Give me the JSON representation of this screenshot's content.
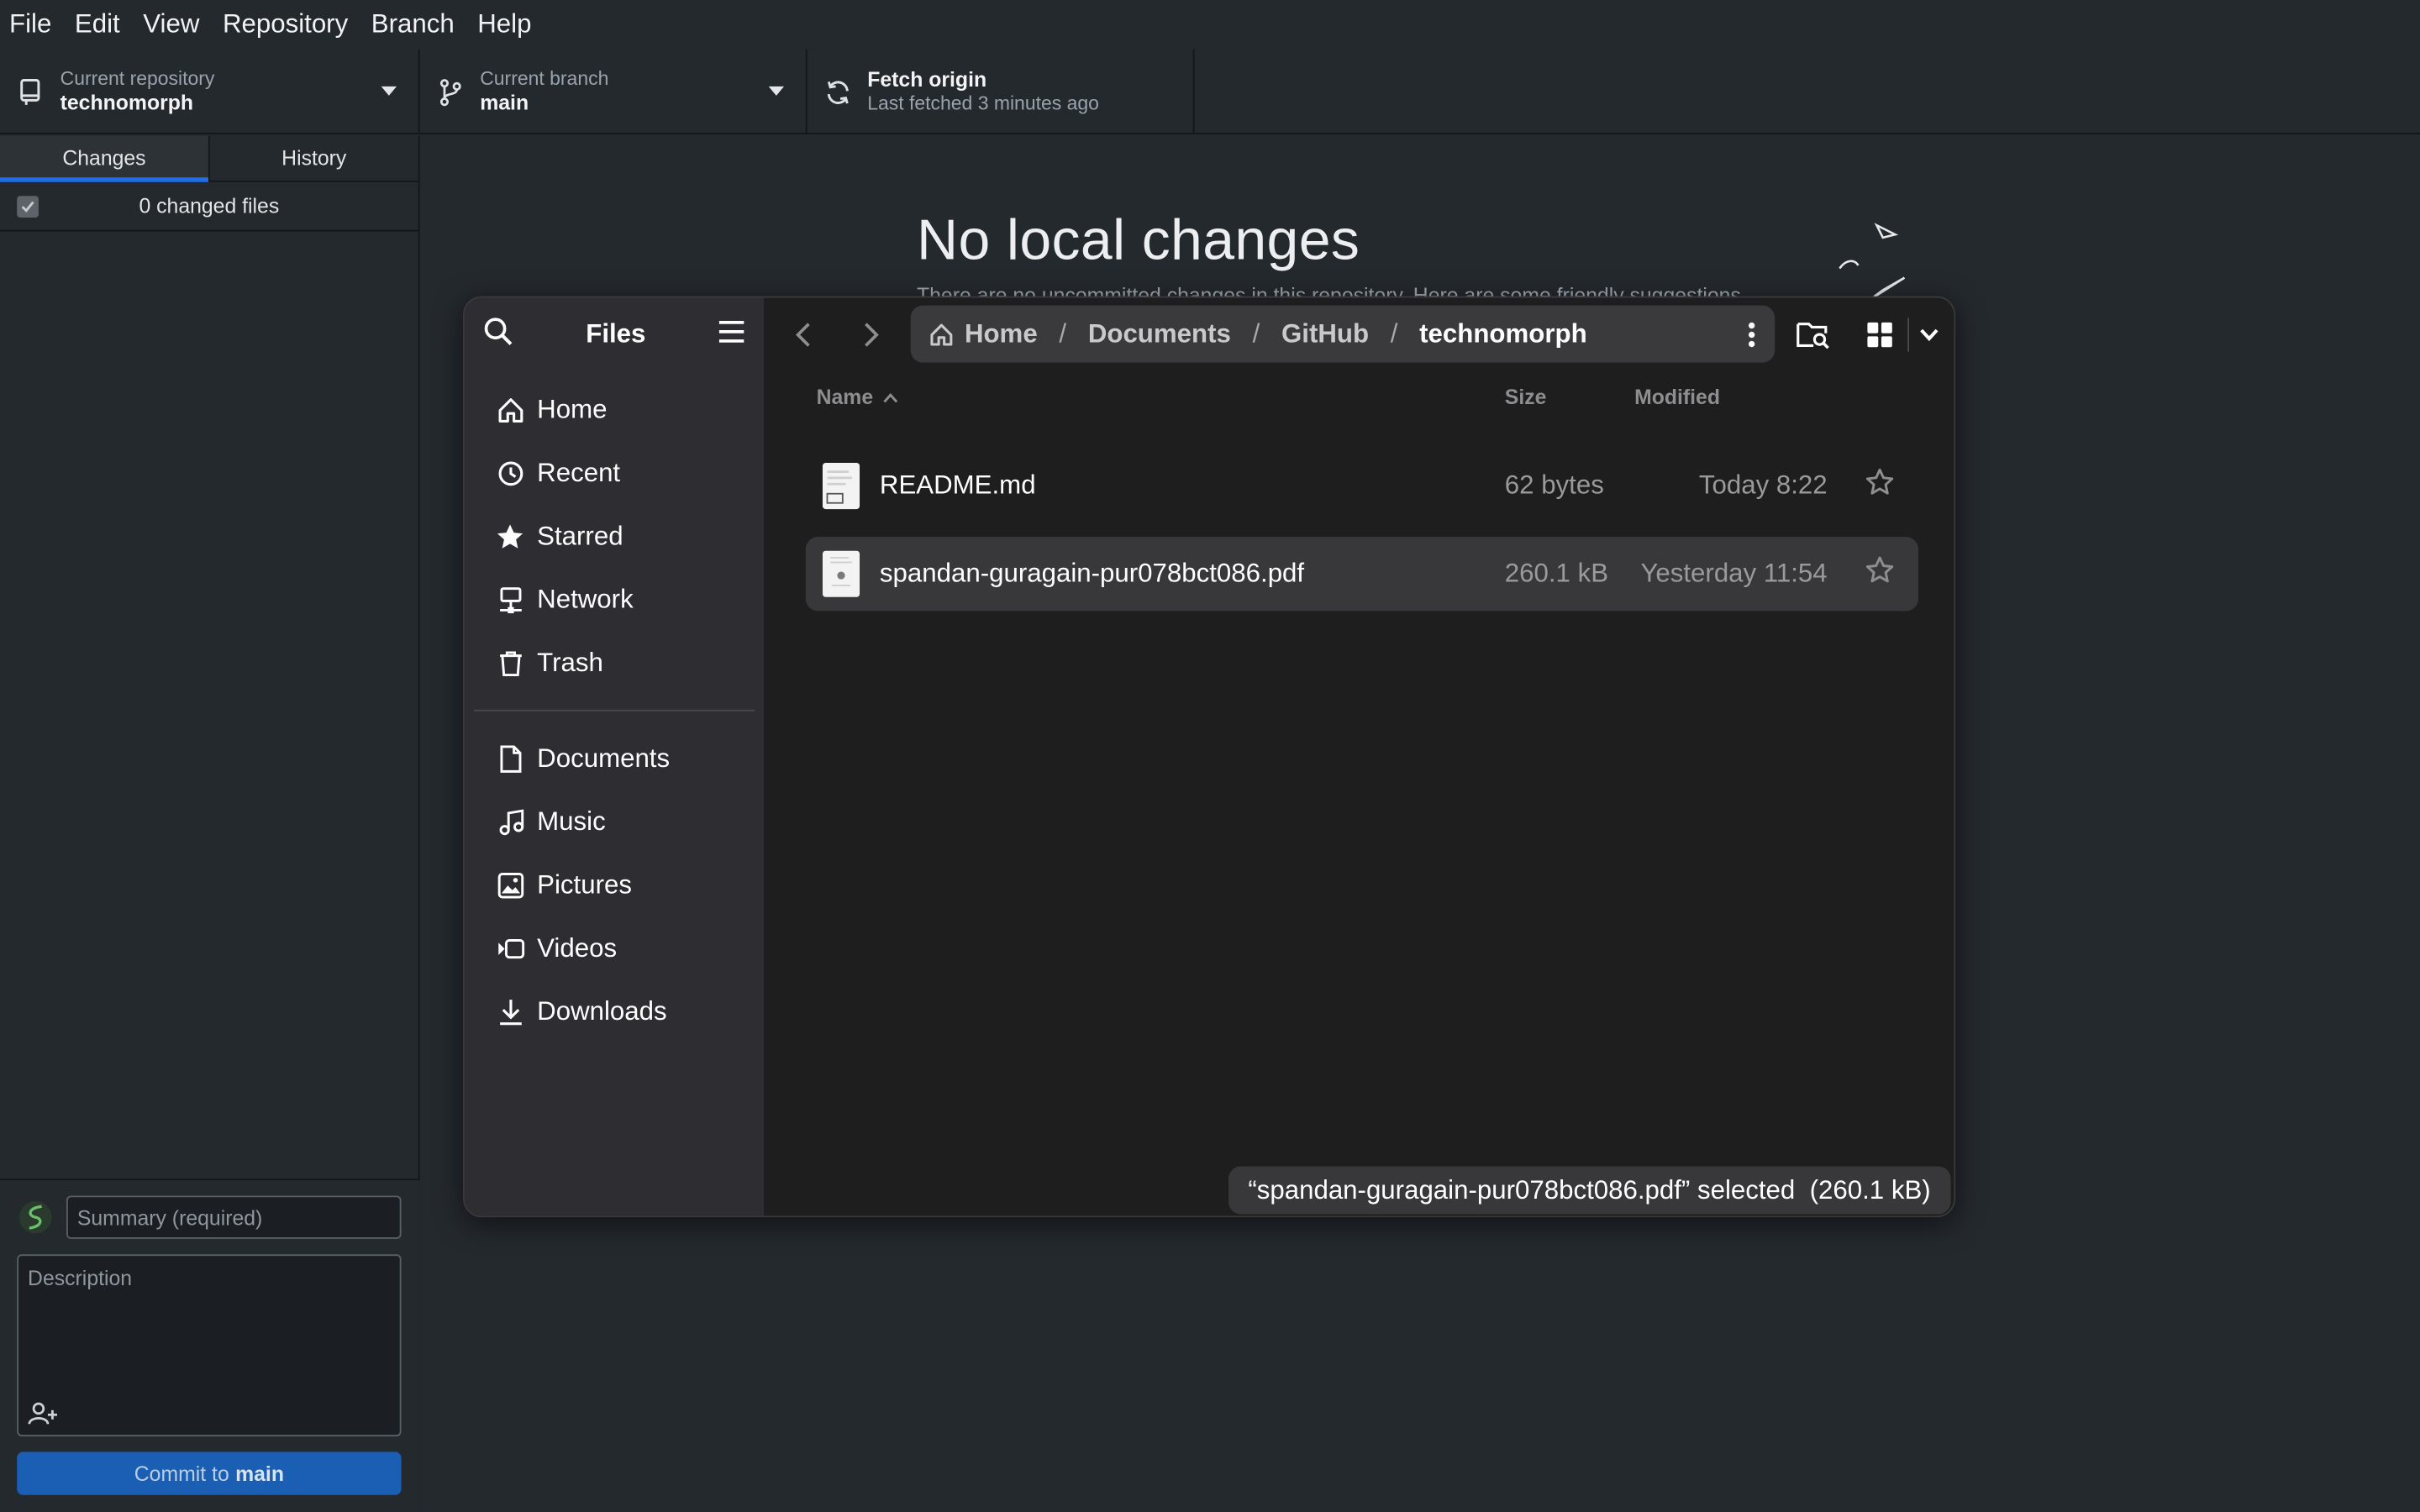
{
  "menu": [
    "File",
    "Edit",
    "View",
    "Repository",
    "Branch",
    "Help"
  ],
  "toolbar": {
    "repo_label": "Current repository",
    "repo_value": "technomorph",
    "branch_label": "Current branch",
    "branch_value": "main",
    "fetch_label": "Fetch origin",
    "fetch_sub": "Last fetched 3 minutes ago"
  },
  "sidebar": {
    "tab_changes": "Changes",
    "tab_history": "History",
    "changed_files": "0 changed files",
    "summary_placeholder": "Summary (required)",
    "description_placeholder": "Description",
    "commit_prefix": "Commit to",
    "commit_branch": "main"
  },
  "main": {
    "title": "No local changes",
    "subtitle": "There are no uncommitted changes in this repository. Here are some friendly suggestions"
  },
  "dialog": {
    "title": "Files",
    "places": [
      {
        "label": "Home",
        "icon": "home-icon"
      },
      {
        "label": "Recent",
        "icon": "recent-icon"
      },
      {
        "label": "Starred",
        "icon": "star-icon"
      },
      {
        "label": "Network",
        "icon": "network-icon"
      },
      {
        "label": "Trash",
        "icon": "trash-icon"
      }
    ],
    "bookmarks": [
      {
        "label": "Documents",
        "icon": "documents-icon"
      },
      {
        "label": "Music",
        "icon": "music-icon"
      },
      {
        "label": "Pictures",
        "icon": "pictures-icon"
      },
      {
        "label": "Videos",
        "icon": "videos-icon"
      },
      {
        "label": "Downloads",
        "icon": "downloads-icon"
      }
    ],
    "breadcrumb": [
      "Home",
      "Documents",
      "GitHub",
      "technomorph"
    ],
    "columns": {
      "name": "Name",
      "size": "Size",
      "modified": "Modified"
    },
    "files": [
      {
        "name": "README.md",
        "size": "62 bytes",
        "modified": "Today 8:22",
        "selected": false
      },
      {
        "name": "spandan-guragain-pur078bct086.pdf",
        "size": "260.1 kB",
        "modified": "Yesterday 11:54",
        "selected": true
      }
    ],
    "status": "“spandan-guragain-pur078bct086.pdf” selected  (260.1 kB)"
  },
  "colors": {
    "app_bg": "#24292e",
    "accent": "#1f6feb",
    "commit_button": "#1a5fb4",
    "dialog_sidebar": "#2e2e32",
    "dialog_bg": "#1e1e1e",
    "selected_row": "#38383a"
  }
}
